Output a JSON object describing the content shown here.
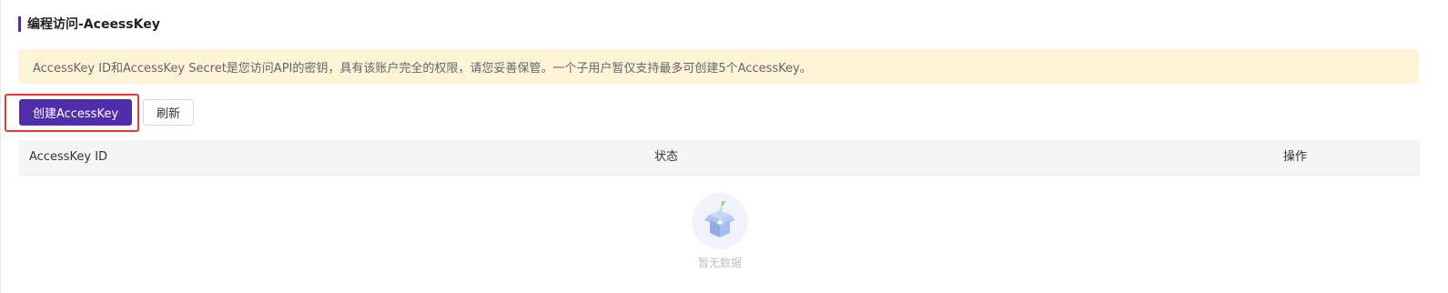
{
  "section": {
    "title": "编程访问-AceessKey"
  },
  "notice": {
    "text": "AccessKey ID和AccessKey Secret是您访问API的密钥，具有该账户完全的权限，请您妥善保管。一个子用户暂仅支持最多可创建5个AccessKey。"
  },
  "toolbar": {
    "create_label": "创建AccessKey",
    "refresh_label": "刷新"
  },
  "table": {
    "columns": [
      "AccessKey ID",
      "状态",
      "操作"
    ],
    "rows": [],
    "empty_text": "暂无数据"
  },
  "colors": {
    "primary": "#4f2dab",
    "notice_bg": "#fdf3d7",
    "highlight": "#e53a2f"
  },
  "icons": {
    "empty_state": "empty-box-icon"
  }
}
